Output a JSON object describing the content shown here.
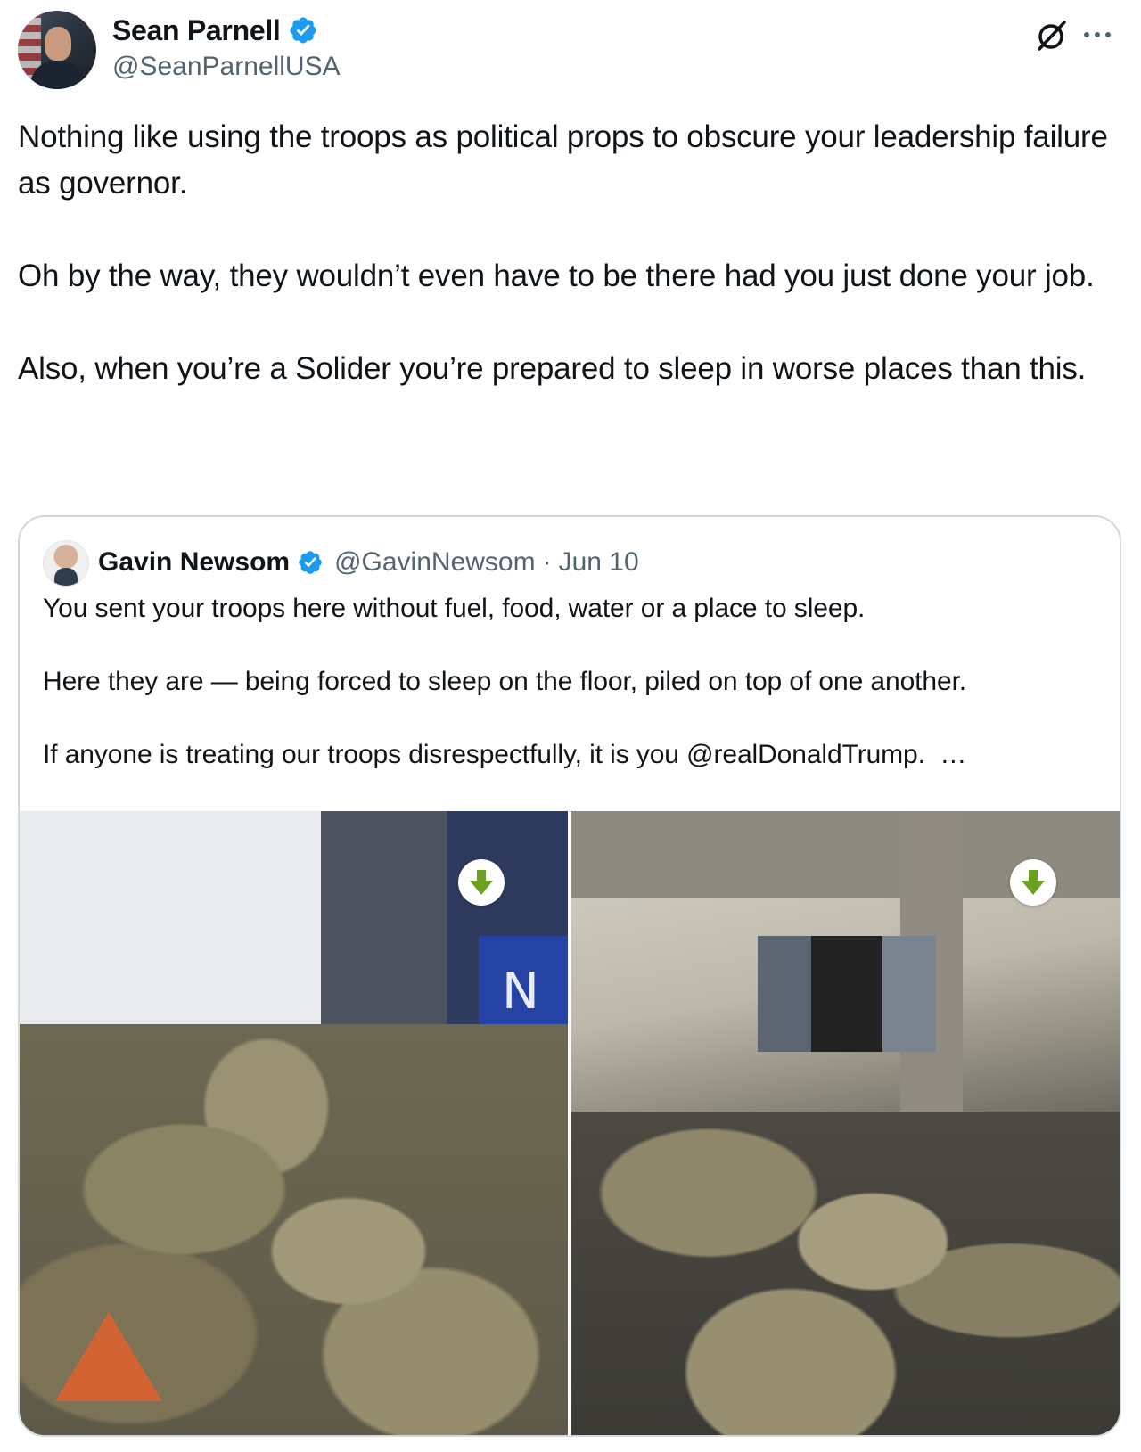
{
  "author": {
    "display_name": "Sean Parnell",
    "handle": "@SeanParnellUSA",
    "verified": true
  },
  "tweet": {
    "text": "Nothing like using the troops as political props to obscure your leadership failure as governor.\n\nOh by the way, they wouldn’t even have to be there had you just done your job.\n\nAlso, when you’re a Solider you’re prepared to sleep in worse places than this."
  },
  "quoted_tweet": {
    "display_name": "Gavin Newsom",
    "handle": "@GavinNewsom",
    "separator": "·",
    "date": "Jun 10",
    "verified": true,
    "text": "You sent your troops here without fuel, food, water or a place to sleep.\n\nHere they are — being forced to sleep on the floor, piled on top of one another.\n\nIf anyone is treating our troops disrespectfully, it is you @realDonaldTrump.  …",
    "photo_sign_letter": "N"
  },
  "colors": {
    "verified_blue": "#1d9bf0",
    "download_green": "#6aa121",
    "secondary_text": "#536471",
    "border": "#cfd9de"
  },
  "icons": {
    "header_actions": [
      "grok-icon",
      "more-icon"
    ],
    "media_overlay": "download-arrow-icon"
  }
}
